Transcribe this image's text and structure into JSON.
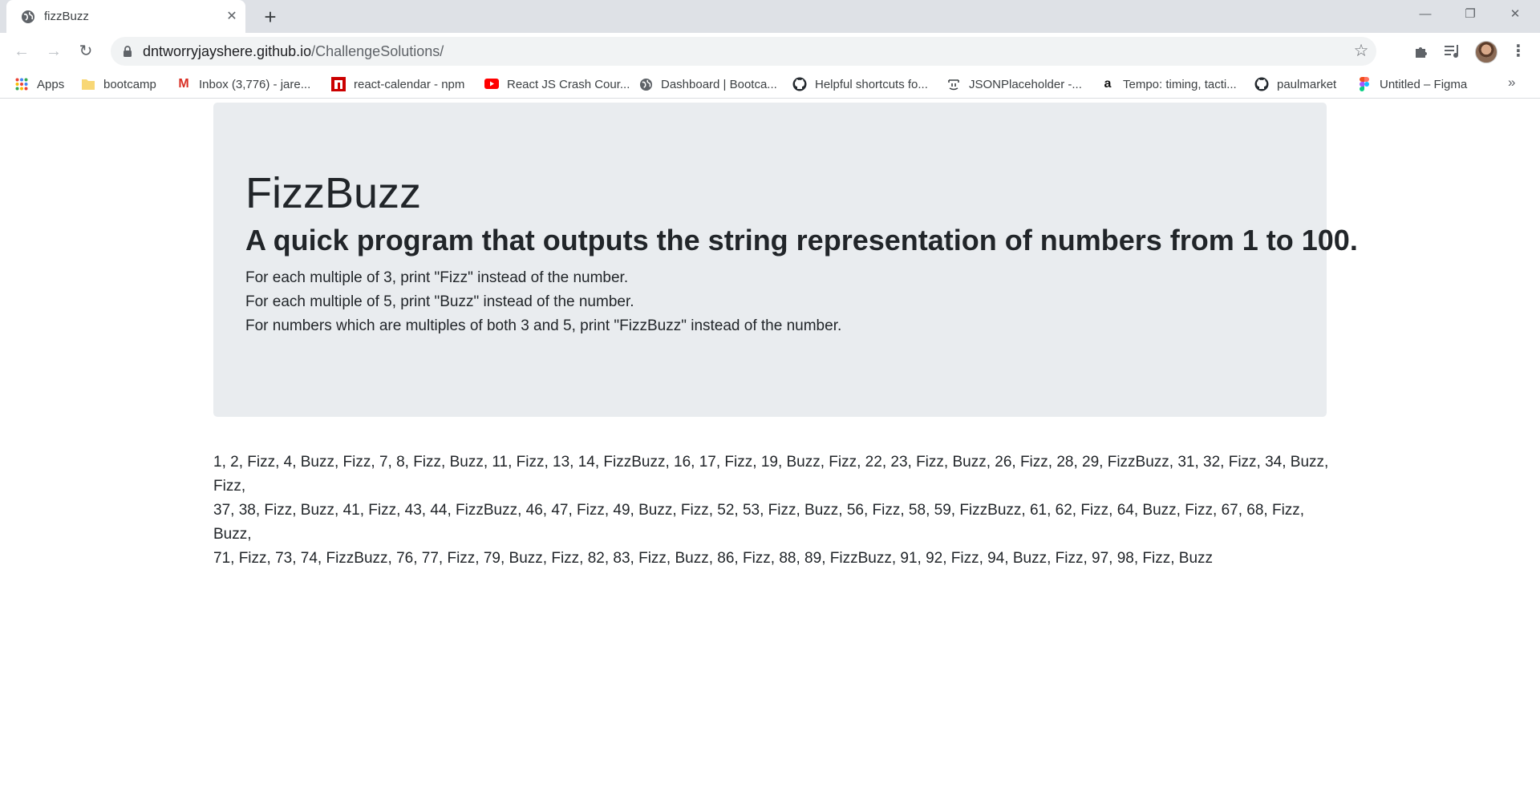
{
  "browser": {
    "tab": {
      "title": "fizzBuzz",
      "close_icon": "close-icon",
      "favicon": "globe-icon"
    },
    "newtab_symbol": "+",
    "window_controls": {
      "minimize": "—",
      "restore": "❐",
      "close": "✕"
    },
    "nav": {
      "back": "←",
      "forward": "→",
      "reload": "↻"
    },
    "address": {
      "host": "dntworryjayshere.github.io",
      "path": "/ChallengeSolutions/"
    },
    "bookmarks": [
      {
        "label": "Apps",
        "icon": "apps-grid-icon"
      },
      {
        "label": "bootcamp",
        "icon": "folder-icon"
      },
      {
        "label": "Inbox (3,776) - jare...",
        "icon": "gmail-icon"
      },
      {
        "label": "react-calendar - npm",
        "icon": "npm-icon"
      },
      {
        "label": "React JS Crash Cour...",
        "icon": "youtube-icon"
      },
      {
        "label": "Dashboard | Bootca...",
        "icon": "globe-icon"
      },
      {
        "label": "Helpful shortcuts fo...",
        "icon": "github-icon"
      },
      {
        "label": "JSONPlaceholder -...",
        "icon": "jsonplaceholder-icon"
      },
      {
        "label": "Tempo: timing, tacti...",
        "icon": "amazon-icon"
      },
      {
        "label": "paulmarket",
        "icon": "github-icon"
      },
      {
        "label": "Untitled – Figma",
        "icon": "figma-icon"
      }
    ],
    "bookmarks_more": "»"
  },
  "page": {
    "title": "FizzBuzz",
    "subtitle": "A quick program that outputs the string representation of numbers from 1 to 100.",
    "rules": [
      "For each multiple of 3, print \"Fizz\" instead of the number.",
      "For each multiple of 5, print \"Buzz\" instead of the number.",
      "For numbers which are multiples of both 3 and 5, print \"FizzBuzz\" instead of the number."
    ],
    "output_lines": [
      "1, 2, Fizz, 4, Buzz, Fizz, 7, 8, Fizz, Buzz, 11, Fizz, 13, 14, FizzBuzz, 16, 17, Fizz, 19, Buzz, Fizz, 22, 23, Fizz, Buzz, 26, Fizz, 28, 29, FizzBuzz, 31, 32, Fizz, 34, Buzz, Fizz,",
      "37, 38, Fizz, Buzz, 41, Fizz, 43, 44, FizzBuzz, 46, 47, Fizz, 49, Buzz, Fizz, 52, 53, Fizz, Buzz, 56, Fizz, 58, 59, FizzBuzz, 61, 62, Fizz, 64, Buzz, Fizz, 67, 68, Fizz, Buzz,",
      "71, Fizz, 73, 74, FizzBuzz, 76, 77, Fizz, 79, Buzz, Fizz, 82, 83, Fizz, Buzz, 86, Fizz, 88, 89, FizzBuzz, 91, 92, Fizz, 94, Buzz, Fizz, 97, 98, Fizz, Buzz"
    ]
  },
  "colors": {
    "tabstrip": "#dee1e6",
    "omnibox": "#f1f3f4",
    "jumbotron": "#e9ecef",
    "text": "#212529"
  }
}
